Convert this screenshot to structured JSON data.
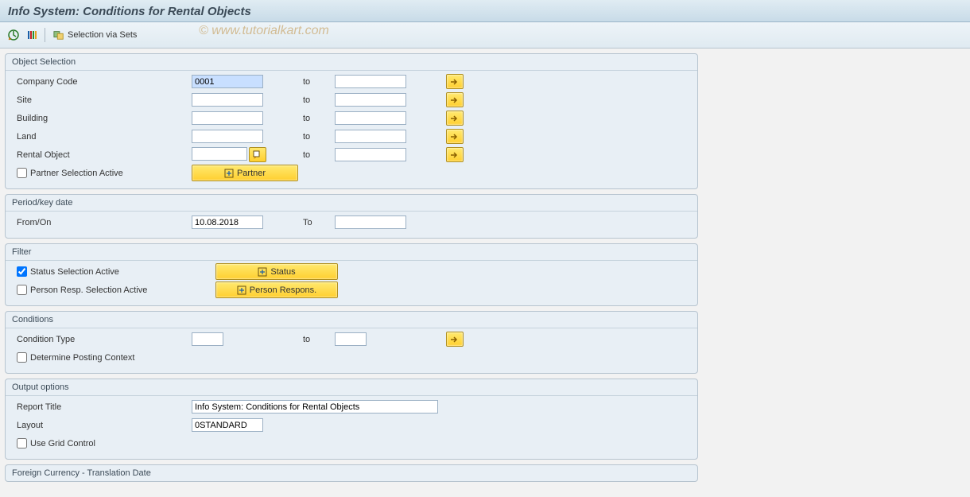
{
  "title": "Info System: Conditions for Rental Objects",
  "toolbar": {
    "selection_via_sets": "Selection via Sets"
  },
  "watermark": "© www.tutorialkart.com",
  "sections": {
    "object_selection": {
      "title": "Object Selection",
      "company_code": "Company Code",
      "company_code_from": "0001",
      "company_code_to": "",
      "site": "Site",
      "site_from": "",
      "site_to": "",
      "building": "Building",
      "building_from": "",
      "building_to": "",
      "land": "Land",
      "land_from": "",
      "land_to": "",
      "rental_object": "Rental Object",
      "rental_object_from": "",
      "rental_object_to": "",
      "to": "to",
      "partner_cb": "Partner Selection Active",
      "partner_btn": "Partner"
    },
    "period": {
      "title": "Period/key date",
      "from_on": "From/On",
      "from_on_value": "10.08.2018",
      "to": "To",
      "to_value": ""
    },
    "filter": {
      "title": "Filter",
      "status_cb": "Status Selection Active",
      "status_btn": "Status",
      "person_cb": "Person Resp. Selection Active",
      "person_btn": "Person Respons."
    },
    "conditions": {
      "title": "Conditions",
      "condition_type": "Condition Type",
      "condition_type_from": "",
      "condition_type_to": "",
      "to": "to",
      "determine_posting_cb": "Determine Posting Context"
    },
    "output": {
      "title": "Output options",
      "report_title_lbl": "Report Title",
      "report_title_val": "Info System: Conditions for Rental Objects",
      "layout_lbl": "Layout",
      "layout_val": "0STANDARD",
      "grid_cb": "Use Grid Control"
    },
    "foreign": {
      "title": "Foreign Currency - Translation Date"
    }
  }
}
